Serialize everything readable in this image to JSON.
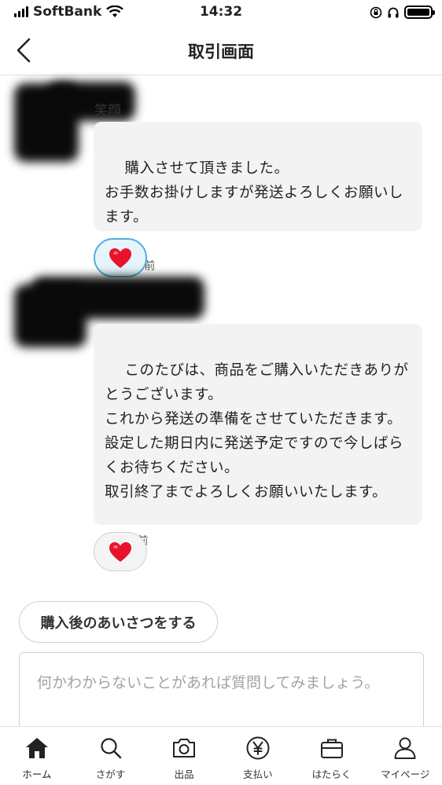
{
  "status_bar": {
    "carrier": "SoftBank",
    "time": "14:32"
  },
  "header": {
    "title": "取引画面"
  },
  "messages": [
    {
      "sender_visible": "笑顔",
      "text": "購入させて頂きました。\nお手数お掛けしますが発送よろしくお願いします。",
      "time": "10 時間前",
      "reaction": "heart",
      "reaction_active": true
    },
    {
      "text": "このたびは、商品をご購入いただきありがとうございます。\nこれから発送の準備をさせていただきます。\n設定した期日内に発送予定ですので今しばらくお待ちください。\n取引終了までよろしくお願いいたします。",
      "time": "7 時間前",
      "reaction": "heart",
      "reaction_active": false
    }
  ],
  "greeting_button": {
    "label": "購入後のあいさつをする"
  },
  "question_input": {
    "placeholder": "何かわからないことがあれば質問してみましょう。"
  },
  "tab_bar": {
    "items": [
      {
        "label": "ホーム",
        "icon": "home-icon"
      },
      {
        "label": "さがす",
        "icon": "search-icon"
      },
      {
        "label": "出品",
        "icon": "camera-icon"
      },
      {
        "label": "支払い",
        "icon": "yen-icon"
      },
      {
        "label": "はたらく",
        "icon": "briefcase-icon"
      },
      {
        "label": "マイページ",
        "icon": "person-icon"
      }
    ]
  },
  "colors": {
    "accent_blue": "#4fb0d8",
    "heart_red": "#e8132a",
    "bubble_bg": "#f3f3f3"
  }
}
